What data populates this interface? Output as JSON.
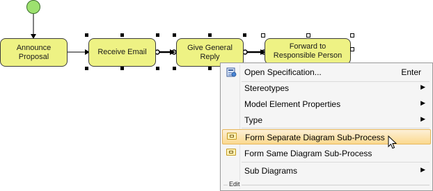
{
  "diagram": {
    "tasks": [
      {
        "id": "announce",
        "label_line1": "Announce",
        "label_line2": "Proposal"
      },
      {
        "id": "receive",
        "label": "Receive Email"
      },
      {
        "id": "reply",
        "label_line1": "Give General",
        "label_line2": "Reply"
      },
      {
        "id": "forward",
        "label_line1": "Forward to",
        "label_line2": "Responsible Person"
      }
    ],
    "start_event_color": "#9de16f",
    "task_fill_color": "#eef284"
  },
  "context_menu": {
    "items": [
      {
        "label": "Open Specification...",
        "shortcut": "Enter",
        "icon": "specification-icon"
      },
      {
        "label": "Stereotypes",
        "submenu": true
      },
      {
        "label": "Model Element Properties",
        "submenu": true
      },
      {
        "label": "Type",
        "submenu": true
      },
      {
        "label": "Form Separate Diagram Sub-Process",
        "icon": "subprocess-icon",
        "highlighted": true
      },
      {
        "label": "Form Same Diagram Sub-Process",
        "icon": "subprocess-icon"
      },
      {
        "label": "Sub Diagrams",
        "submenu": true
      }
    ],
    "group_label": "Edit",
    "highlight_color": "#fbd98e"
  }
}
